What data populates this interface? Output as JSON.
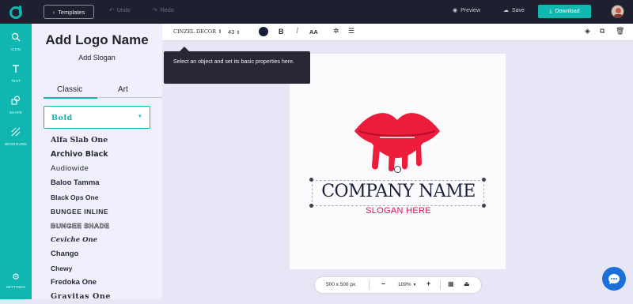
{
  "topbar": {
    "templates_label": "Templates",
    "undo_label": "Undo",
    "redo_label": "Redo",
    "preview_label": "Preview",
    "save_label": "Save",
    "download_label": "Download"
  },
  "iconbar": {
    "items": [
      {
        "label": "ICON",
        "icon": "search-icon"
      },
      {
        "label": "TEXT",
        "icon": "text-icon"
      },
      {
        "label": "SHAPE",
        "icon": "shape-icon"
      },
      {
        "label": "BKGROUND",
        "icon": "background-icon"
      }
    ],
    "settings_label": "SETTINGS"
  },
  "panel": {
    "title": "Add Logo Name",
    "subtitle": "Add Slogan",
    "tabs": [
      "Classic",
      "Art"
    ],
    "active_tab": "Classic",
    "selected_font": "Bold",
    "fonts": [
      "Alfa Slab One",
      "Archivo Black",
      "Audiowide",
      "Baloo Tamma",
      "Black Ops One",
      "BUNGEE INLINE",
      "BUNGEE SHADE",
      "Ceviche One",
      "Chango",
      "Chewy",
      "Fredoka One",
      "Gravitas One"
    ]
  },
  "toolbar": {
    "font_name": "CINZEL DECOR",
    "font_size": "43",
    "text_color": "#1a1d3a",
    "bold_label": "B",
    "italic_label": "I",
    "case_label": "AA"
  },
  "tooltip": {
    "text": "Select an object and set its basic properties here."
  },
  "canvas": {
    "company_name": "COMPANY NAME",
    "slogan": "SLOGAN HERE",
    "lips_color": "#ee1c3b",
    "brand_color": "#10b6b0"
  },
  "bottombar": {
    "size_label": "500 x 500 px",
    "zoom_label": "109%",
    "minus_label": "–",
    "plus_label": "+"
  }
}
